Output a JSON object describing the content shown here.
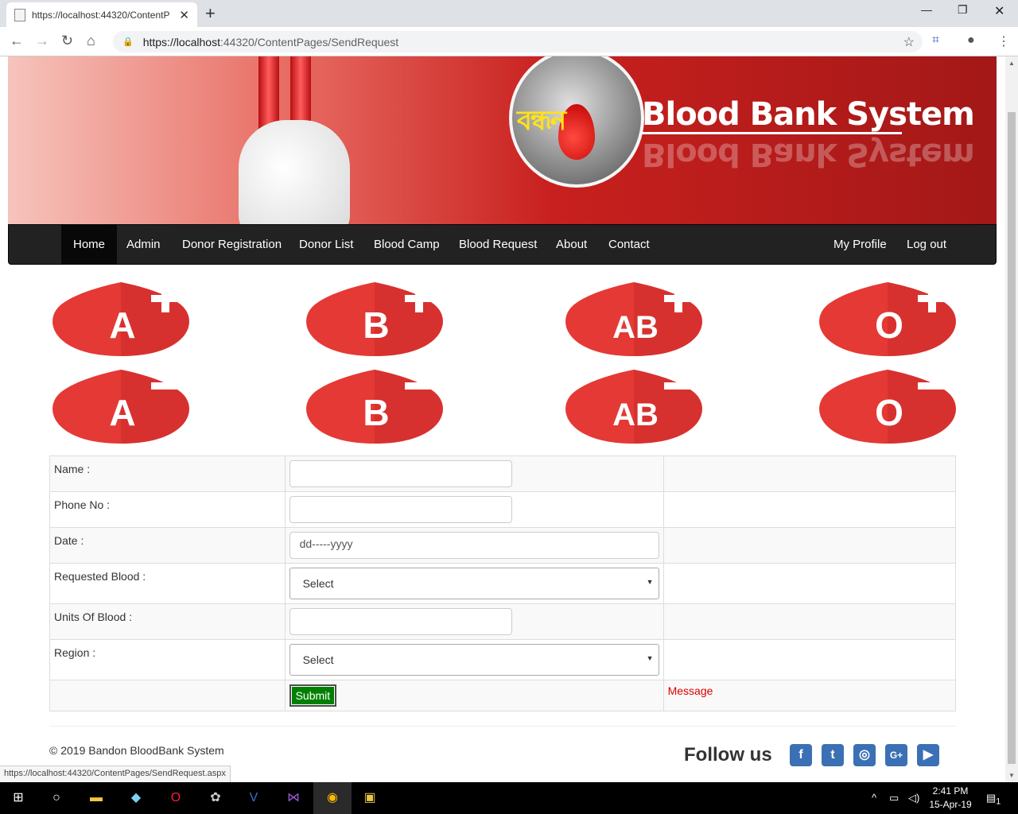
{
  "browser": {
    "tab_title": "https://localhost:44320/ContentP",
    "url_host": "https://localhost",
    "url_path": ":44320/ContentPages/SendRequest",
    "status_url": "https://localhost:44320/ContentPages/SendRequest.aspx"
  },
  "banner": {
    "bengali_title": "বন্ধন",
    "brand": "Blood Bank System"
  },
  "nav": {
    "left": [
      "Home",
      "Admin",
      "Donor Registration",
      "Donor List",
      "Blood Camp",
      "Blood Request",
      "About",
      "Contact"
    ],
    "active": "Home",
    "right": [
      "My Profile",
      "Log out"
    ]
  },
  "blood_groups": [
    {
      "label": "A",
      "sign": "+"
    },
    {
      "label": "B",
      "sign": "+"
    },
    {
      "label": "AB",
      "sign": "+"
    },
    {
      "label": "O",
      "sign": "+"
    },
    {
      "label": "A",
      "sign": "-"
    },
    {
      "label": "B",
      "sign": "-"
    },
    {
      "label": "AB",
      "sign": "-"
    },
    {
      "label": "O",
      "sign": "-"
    }
  ],
  "form": {
    "name_label": "Name :",
    "phone_label": "Phone No :",
    "date_label": "Date :",
    "date_placeholder": "dd-----yyyy",
    "blood_label": "Requested Blood :",
    "blood_selected": "Select",
    "units_label": "Units Of Blood :",
    "region_label": "Region :",
    "region_selected": "Select",
    "submit_label": "Submit",
    "message": "Message"
  },
  "footer": {
    "copyright": "© 2019 Bandon BloodBank System",
    "follow": "Follow us",
    "social": [
      "facebook-icon",
      "twitter-icon",
      "instagram-icon",
      "google-plus-icon",
      "youtube-icon"
    ]
  },
  "taskbar": {
    "time": "2:41 PM",
    "date": "15-Apr-19",
    "notifications": "1"
  },
  "colors": {
    "banner_red": "#c8201e",
    "navbar": "#222222",
    "submit_green": "#008000",
    "message_red": "#dd0000",
    "social_blue": "#3b70b5"
  }
}
